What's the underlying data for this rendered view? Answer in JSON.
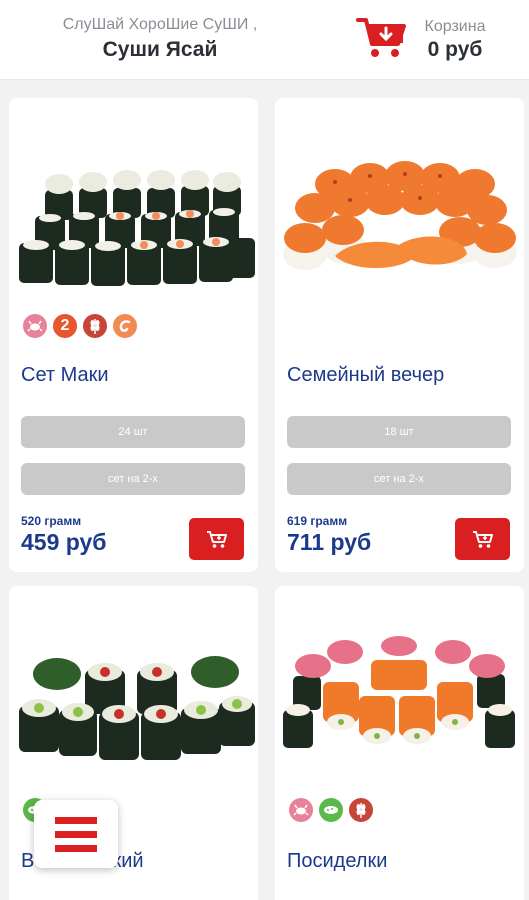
{
  "header": {
    "slogan": "СлуШай ХороШие СуШИ ,",
    "brand": "Суши Ясай",
    "cart_label": "Корзина",
    "cart_total": "0 руб",
    "cart_icon": "cart-icon"
  },
  "products": [
    {
      "name": "Сет Маки",
      "badges": [
        "crab-icon",
        "2",
        "wheat-icon",
        "shrimp-icon"
      ],
      "option1": "24 шт",
      "option2": "сет на 2-х",
      "weight": "520 грамм",
      "price": "459 руб"
    },
    {
      "name": "Семейный вечер",
      "option1": "18 шт",
      "option2": "сет на 2-х",
      "weight": "619 грамм",
      "price": "711 руб"
    },
    {
      "name_visible_left": "В",
      "name_visible_right": "анский",
      "badges": [
        "cucumber-icon"
      ]
    },
    {
      "name": "Посиделки",
      "badges": [
        "crab-icon",
        "cucumber-icon",
        "wheat-icon"
      ]
    }
  ],
  "colors": {
    "accent_red": "#d91f1f",
    "title_blue": "#1c3a8c",
    "option_gray": "#c9c9c9"
  }
}
